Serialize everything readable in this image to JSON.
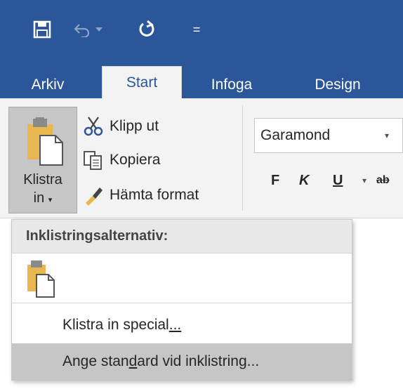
{
  "quick_access": {
    "save_icon": "save-icon",
    "undo_icon": "undo-icon",
    "redo_icon": "redo-icon",
    "customize_glyph": "="
  },
  "tabs": [
    {
      "label": "Arkiv"
    },
    {
      "label": "Start"
    },
    {
      "label": "Infoga"
    },
    {
      "label": "Design"
    }
  ],
  "clipboard": {
    "paste_label_line1": "Klistra",
    "paste_label_line2": "in",
    "cut_label": "Klipp ut",
    "copy_label": "Kopiera",
    "format_painter_label": "Hämta format"
  },
  "font": {
    "name": "Garamond",
    "bold": "F",
    "italic": "K",
    "underline": "U",
    "strikethrough": "ab"
  },
  "paste_menu": {
    "header": "Inklistringsalternativ:",
    "special_prefix": "Klistra in special",
    "special_suffix": "...",
    "default_prefix": "Ange stan",
    "default_accel": "d",
    "default_suffix": "ard vid inklistring..."
  },
  "colors": {
    "ribbon_blue": "#2b579a",
    "ribbon_bg": "#f3f3f3",
    "selected_gray": "#c6c6c6",
    "clipboard_gold": "#e8b84f"
  }
}
